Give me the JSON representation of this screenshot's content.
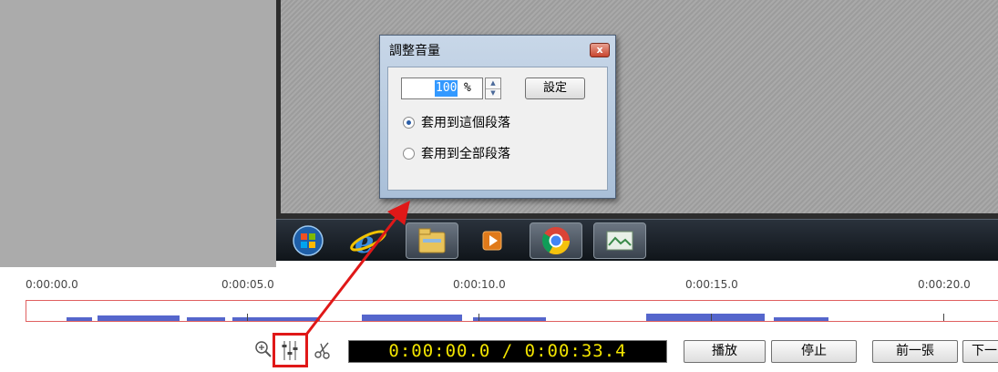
{
  "dialog": {
    "title": "調整音量",
    "close_glyph": "x",
    "volume_value": "100",
    "volume_unit": "%",
    "set_label": "設定",
    "spin_up": "▲",
    "spin_down": "▼",
    "radio_options": [
      {
        "label": "套用到這個段落",
        "selected": true
      },
      {
        "label": "套用到全部段落",
        "selected": false
      }
    ]
  },
  "taskbar": {
    "items": [
      "start-orb-icon",
      "internet-explorer-icon",
      "file-explorer-icon",
      "media-player-icon",
      "chrome-icon",
      "photo-viewer-icon"
    ]
  },
  "timeline": {
    "ticks": [
      "0:00:00.0",
      "0:00:05.0",
      "0:00:10.0",
      "0:00:15.0",
      "0:00:20.0"
    ],
    "waveform_color": "#5566cc",
    "boundary_color": "#e06060"
  },
  "toolbar": {
    "time_display": "0:00:00.0 / 0:00:33.4",
    "play_label": "播放",
    "stop_label": "停止",
    "prev_label": "前一張",
    "next_label": "下一",
    "highlight_color": "#e01818",
    "icons": [
      "zoom-icon",
      "mixer-icon",
      "scissors-icon"
    ]
  }
}
